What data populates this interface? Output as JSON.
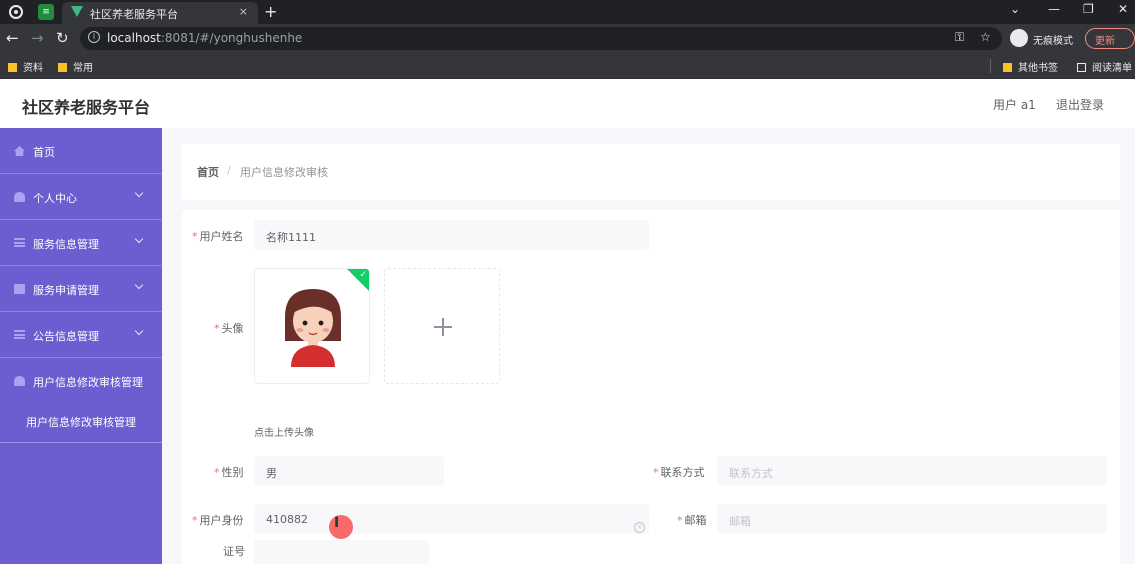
{
  "browser": {
    "tab_title": "社区养老服务平台",
    "tab_close": "×",
    "new_tab": "+",
    "url_host": "localhost",
    "url_rest": ":8081/#/yonghushenhe",
    "incognito_label": "无痕模式",
    "update_label": "更新",
    "bookmarks": [
      "资料",
      "常用"
    ],
    "bookmarks_right": [
      "其他书签",
      "阅读清单"
    ]
  },
  "app": {
    "brand": "社区养老服务平台",
    "user_label": "用户 a1",
    "logout_label": "退出登录"
  },
  "sidebar": {
    "items": [
      {
        "label": "首页",
        "icon": "home-icon",
        "expandable": false
      },
      {
        "label": "个人中心",
        "icon": "user-icon",
        "expandable": true
      },
      {
        "label": "服务信息管理",
        "icon": "list-icon",
        "expandable": true
      },
      {
        "label": "服务申请管理",
        "icon": "clipboard-icon",
        "expandable": true
      },
      {
        "label": "公告信息管理",
        "icon": "list-icon",
        "expandable": true
      },
      {
        "label": "用户信息修改审核管理",
        "icon": "user-icon",
        "expandable": true
      }
    ],
    "sub_item": "用户信息修改审核管理",
    "accent_color": "#6a5ed0"
  },
  "breadcrumb": {
    "home": "首页",
    "separator": "/",
    "current": "用户信息修改审核"
  },
  "form": {
    "name_label": "用户姓名",
    "name_value": "名称1111",
    "avatar_label": "头像",
    "upload_tip": "点击上传头像",
    "gender_label": "性别",
    "gender_value": "男",
    "phone_label": "联系方式",
    "phone_placeholder": "联系方式",
    "idcard_label_1": "用户身份",
    "idcard_label_2": "证号",
    "idcard_value": "410882",
    "email_label": "邮箱",
    "email_placeholder": "邮箱",
    "required_mark": "*"
  }
}
